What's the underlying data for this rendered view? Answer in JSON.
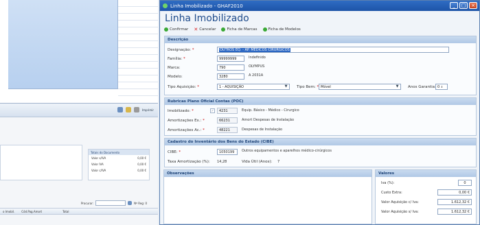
{
  "window": {
    "title": "Linha Imobilizado - GHAF2010",
    "heading": "Linha Imobilizado"
  },
  "actions": {
    "confirm": "Confirmar",
    "cancel": "Cancelar",
    "ficha_marcas": "Ficha de Marcas",
    "ficha_modelos": "Ficha de Modelos"
  },
  "descricao": {
    "header": "Descrição",
    "designacao_label": "Designação:",
    "designacao_value": "OUTROS EQ. - AP. MEDICOS CIRURGICOS",
    "familia_label": "Família:",
    "familia_code": "99999999",
    "familia_desc": "Indefinido",
    "marca_label": "Marca:",
    "marca_code": "790",
    "marca_desc": "OLYMPUS",
    "modelo_label": "Modelo:",
    "modelo_code": "3280",
    "modelo_desc": "A 2031A",
    "tipo_aquisicao_label": "Tipo Aquisição:",
    "tipo_aquisicao_value": "1 - AQUISIÇÃO",
    "tipo_bem_label": "Tipo Bem:",
    "tipo_bem_value": "Móvel",
    "anos_garantia_label": "Anos Garantia:",
    "anos_garantia_value": "0"
  },
  "poc": {
    "header": "Rubricas Plano Oficial Contas (POC)",
    "imobilizado_label": "Imobilizado:",
    "imobilizado_code": "4231",
    "imobilizado_desc": "Equip. Básico - Médico - Cirurgico",
    "amort_ex_label": "Amortizações Ex.:",
    "amort_ex_code": "66231",
    "amort_ex_desc": "Amort Despesas de Instalação",
    "amort_ac_label": "Amortizações Ac.:",
    "amort_ac_code": "48221",
    "amort_ac_desc": "Despesas de Instalação"
  },
  "cibe": {
    "header": "Cadastro do Inventário dos Bens do Estado (CIBE)",
    "cibe_label": "CIBE:",
    "cibe_code": "1050199",
    "cibe_desc": "Outros equipamentos e aparelhos médico-cirúrgicos",
    "taxa_label": "Taxa Amortização (%):",
    "taxa_value": "14,28",
    "vida_label": "Vida Útil (Anos):",
    "vida_value": "7"
  },
  "observacoes": {
    "header": "Observações"
  },
  "valores": {
    "header": "Valores",
    "iva_label": "Iva (%):",
    "iva_value": "0",
    "custo_label": "Custo Extra:",
    "custo_value": "0,00 €",
    "vaq_civa_label": "Valor Aquisição c/ Iva:",
    "vaq_civa_value": "1.612,32 €",
    "vaq_siva_label": "Valor Aquisição s/ Iva:",
    "vaq_siva_value": "1.612,32 €"
  },
  "background_window": {
    "panel_header": "Totais do Documento",
    "rows": [
      {
        "label": "Valor s/IVA",
        "value": "0,00 €"
      },
      {
        "label": "Valor IVA",
        "value": "0,00 €"
      },
      {
        "label": "Valor c/IVA",
        "value": "0,00 €"
      }
    ],
    "search_label": "Procurar:",
    "page_label": "Nº Reg: 0",
    "grid_headers": [
      "o Imobil.",
      "Cód.Pag.Amort",
      "Total"
    ],
    "toolbar_label": "Imprimir"
  },
  "colors": {
    "titlebar": "#1d54a8",
    "heading": "#1f4c8c",
    "section_header": "#b0c8e6",
    "selection": "#2a66c2"
  }
}
